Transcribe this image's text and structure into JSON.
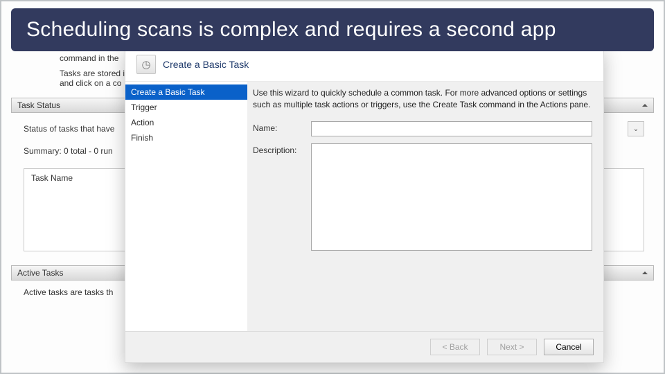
{
  "banner": "Scheduling scans is complex and requires a second app",
  "overview": {
    "line1": "command in the",
    "line2": "Tasks are stored i",
    "line3": "and click on a co"
  },
  "task_status": {
    "header": "Task Status",
    "status_text": "Status of tasks that have",
    "summary": "Summary: 0 total - 0 run",
    "task_name_header": "Task Name"
  },
  "active_tasks": {
    "header": "Active Tasks",
    "body": "Active tasks are tasks th"
  },
  "wizard": {
    "title": "Create a Basic Task",
    "nav": [
      "Create a Basic Task",
      "Trigger",
      "Action",
      "Finish"
    ],
    "info": "Use this wizard to quickly schedule a common task.  For more advanced options or settings such as multiple task actions or triggers, use the Create Task command in the Actions pane.",
    "name_label": "Name:",
    "desc_label": "Description:",
    "name_value": "",
    "desc_value": "",
    "buttons": {
      "back": "< Back",
      "next": "Next >",
      "cancel": "Cancel"
    }
  }
}
